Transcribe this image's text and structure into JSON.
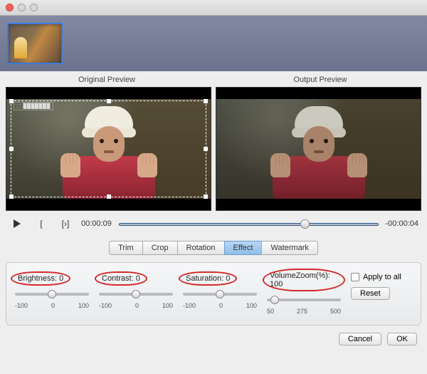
{
  "previews": {
    "original": "Original Preview",
    "output": "Output Preview",
    "watermark": "⬚ ███████"
  },
  "transport": {
    "bracket_in": "[",
    "bracket_out": "[›]",
    "current": "00:00:09",
    "remaining": "-00:00:04",
    "progress_pct": 70
  },
  "tabs": [
    {
      "label": "Trim",
      "active": false
    },
    {
      "label": "Crop",
      "active": false
    },
    {
      "label": "Rotation",
      "active": false
    },
    {
      "label": "Effect",
      "active": true
    },
    {
      "label": "Watermark",
      "active": false
    }
  ],
  "effects": {
    "brightness": {
      "label": "Brightness:",
      "value": "0",
      "min": "-100",
      "mid": "0",
      "max": "100",
      "thumb_pct": 50
    },
    "contrast": {
      "label": "Contrast:",
      "value": "0",
      "min": "-100",
      "mid": "0",
      "max": "100",
      "thumb_pct": 50
    },
    "saturation": {
      "label": "Saturation:",
      "value": "0",
      "min": "-100",
      "mid": "0",
      "max": "100",
      "thumb_pct": 50
    },
    "volumezoom": {
      "label": "VolumeZoom(%):",
      "value": "100",
      "min": "50",
      "mid": "275",
      "max": "500",
      "thumb_pct": 11
    }
  },
  "apply_all": "Apply to all",
  "reset": "Reset",
  "footer": {
    "cancel": "Cancel",
    "ok": "OK"
  }
}
